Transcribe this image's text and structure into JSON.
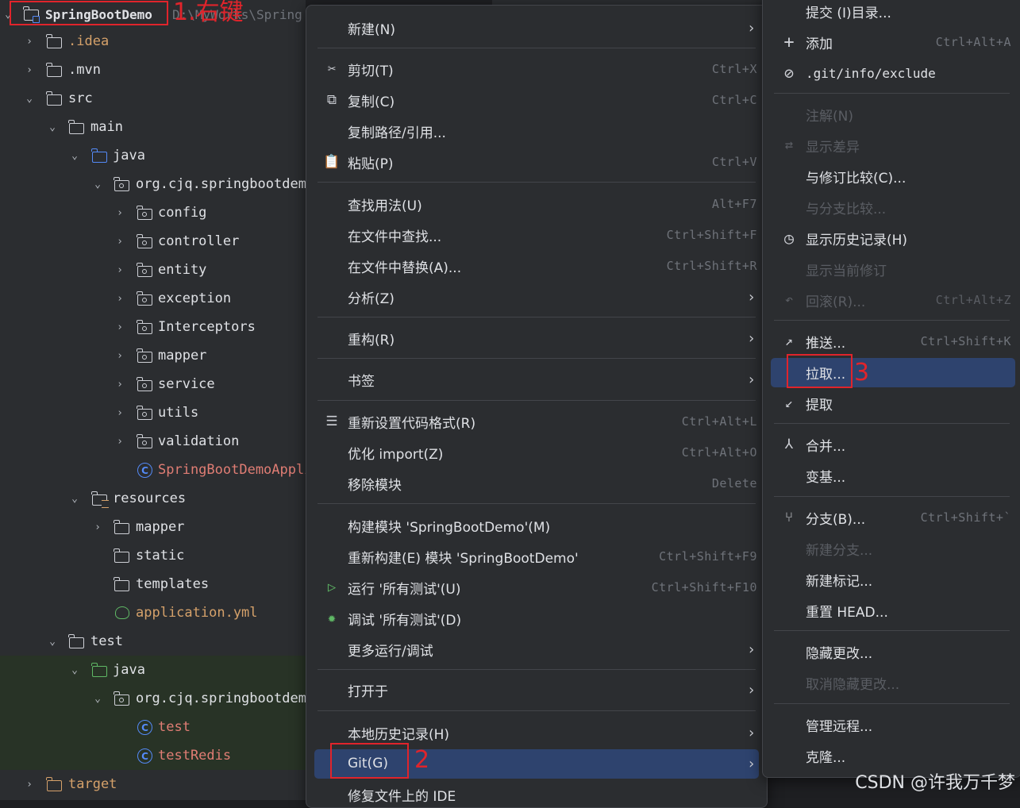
{
  "project_tree": {
    "root_label": "SpringBootDemo",
    "root_path": "D:\\MyWorks\\Spring",
    "items": [
      {
        "label": ".idea"
      },
      {
        "label": ".mvn"
      },
      {
        "label": "src"
      },
      {
        "label": "main"
      },
      {
        "label": "java"
      },
      {
        "label": "org.cjq.springbootdemo"
      },
      {
        "label": "config"
      },
      {
        "label": "controller"
      },
      {
        "label": "entity"
      },
      {
        "label": "exception"
      },
      {
        "label": "Interceptors"
      },
      {
        "label": "mapper"
      },
      {
        "label": "service"
      },
      {
        "label": "utils"
      },
      {
        "label": "validation"
      },
      {
        "label": "SpringBootDemoApplication"
      },
      {
        "label": "resources"
      },
      {
        "label": "mapper"
      },
      {
        "label": "static"
      },
      {
        "label": "templates"
      },
      {
        "label": "application.yml"
      },
      {
        "label": "test"
      },
      {
        "label": "java"
      },
      {
        "label": "org.cjq.springbootdemo"
      },
      {
        "label": "test"
      },
      {
        "label": "testRedis"
      },
      {
        "label": "target"
      }
    ]
  },
  "context_menu": {
    "items": [
      {
        "label": "新建(N)"
      },
      {
        "label": "剪切(T)",
        "shortcut": "Ctrl+X"
      },
      {
        "label": "复制(C)",
        "shortcut": "Ctrl+C"
      },
      {
        "label": "复制路径/引用..."
      },
      {
        "label": "粘贴(P)",
        "shortcut": "Ctrl+V"
      },
      {
        "label": "查找用法(U)",
        "shortcut": "Alt+F7"
      },
      {
        "label": "在文件中查找...",
        "shortcut": "Ctrl+Shift+F"
      },
      {
        "label": "在文件中替换(A)...",
        "shortcut": "Ctrl+Shift+R"
      },
      {
        "label": "分析(Z)"
      },
      {
        "label": "重构(R)"
      },
      {
        "label": "书签"
      },
      {
        "label": "重新设置代码格式(R)",
        "shortcut": "Ctrl+Alt+L"
      },
      {
        "label": "优化 import(Z)",
        "shortcut": "Ctrl+Alt+O"
      },
      {
        "label": "移除模块",
        "shortcut": "Delete"
      },
      {
        "label": "构建模块 'SpringBootDemo'(M)"
      },
      {
        "label": "重新构建(E) 模块 'SpringBootDemo'",
        "shortcut": "Ctrl+Shift+F9"
      },
      {
        "label": "运行 '所有测试'(U)",
        "shortcut": "Ctrl+Shift+F10"
      },
      {
        "label": "调试 '所有测试'(D)"
      },
      {
        "label": "更多运行/调试"
      },
      {
        "label": "打开于"
      },
      {
        "label": "本地历史记录(H)"
      },
      {
        "label": "Git(G)"
      },
      {
        "label": "修复文件上的 IDE"
      }
    ]
  },
  "git_submenu": {
    "items": [
      {
        "label": "提交 (I)目录..."
      },
      {
        "label": "添加",
        "shortcut": "Ctrl+Alt+A"
      },
      {
        "label": ".git/info/exclude"
      },
      {
        "label": "注解(N)"
      },
      {
        "label": "显示差异"
      },
      {
        "label": "与修订比较(C)..."
      },
      {
        "label": "与分支比较..."
      },
      {
        "label": "显示历史记录(H)"
      },
      {
        "label": "显示当前修订"
      },
      {
        "label": "回滚(R)...",
        "shortcut": "Ctrl+Alt+Z"
      },
      {
        "label": "推送...",
        "shortcut": "Ctrl+Shift+K"
      },
      {
        "label": "拉取..."
      },
      {
        "label": "提取"
      },
      {
        "label": "合并..."
      },
      {
        "label": "变基..."
      },
      {
        "label": "分支(B)...",
        "shortcut": "Ctrl+Shift+`"
      },
      {
        "label": "新建分支..."
      },
      {
        "label": "新建标记..."
      },
      {
        "label": "重置 HEAD..."
      },
      {
        "label": "隐藏更改..."
      },
      {
        "label": "取消隐藏更改..."
      },
      {
        "label": "管理远程..."
      },
      {
        "label": "克隆..."
      }
    ]
  },
  "annotations": {
    "step1": "1.右键",
    "step2": "2",
    "step3": "3"
  },
  "watermark": "CSDN @许我万千梦",
  "colors": {
    "highlight": "#2e436e",
    "annotation_red": "#e0242b",
    "background": "#2b2d30"
  }
}
